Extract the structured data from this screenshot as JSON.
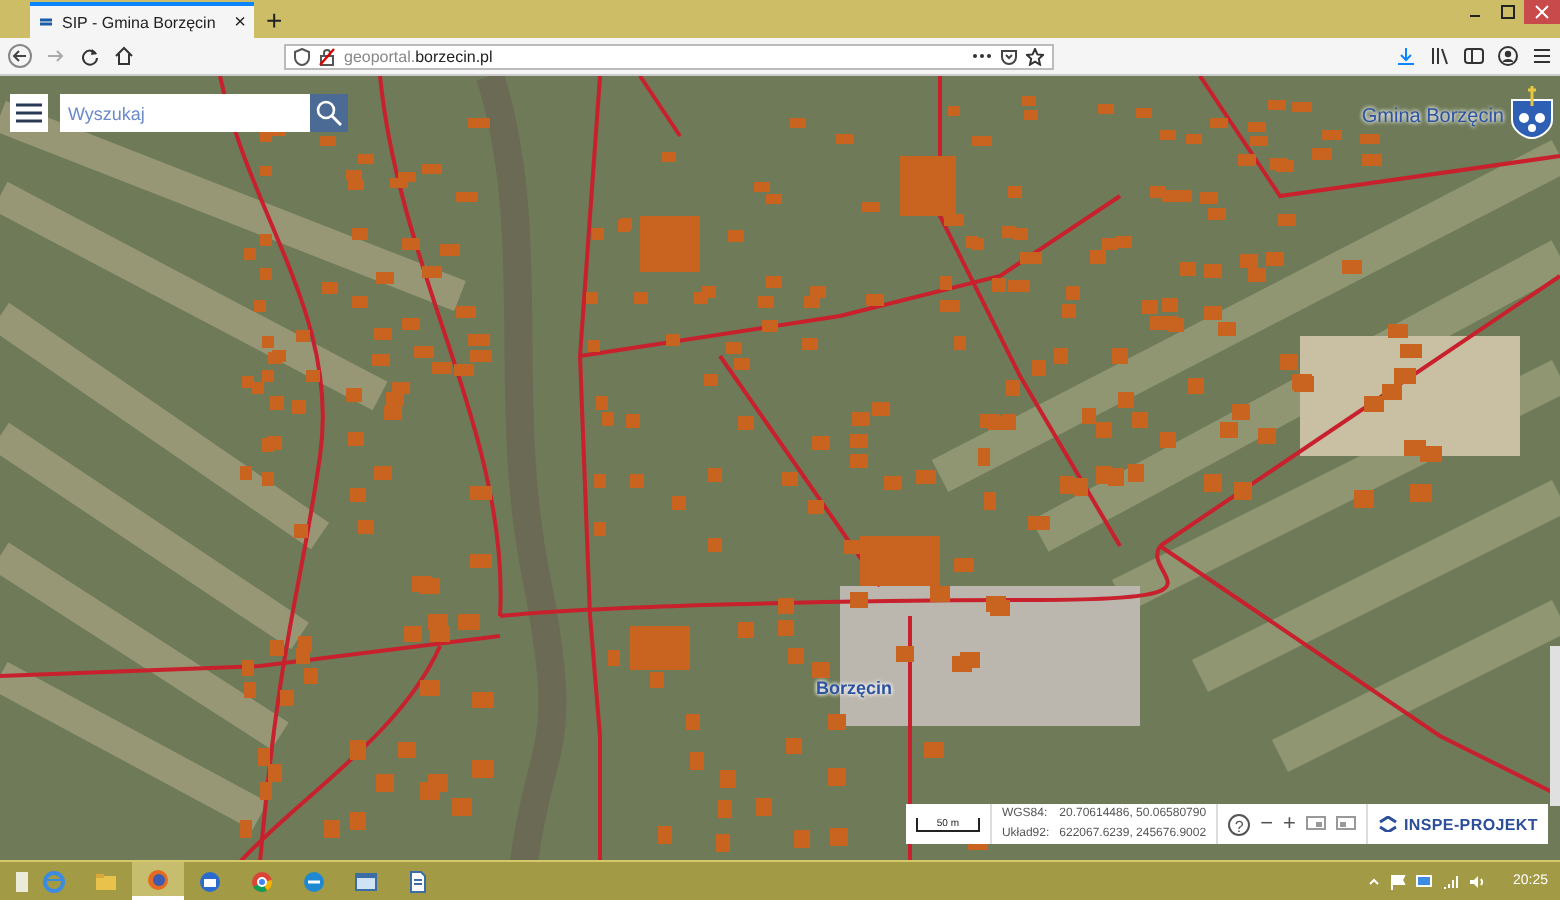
{
  "browser": {
    "tab": {
      "title": "SIP - Gmina Borzęcin",
      "close": "×",
      "selected": true
    },
    "new_tab": "+",
    "url": {
      "subdomain": "geoportal.",
      "domain": "borzecin.pl"
    }
  },
  "map": {
    "search": {
      "placeholder": "Wyszukaj"
    },
    "brand": "Gmina Borzęcin",
    "labels": [
      {
        "text": "Borzęcin"
      }
    ],
    "scale": "50 m",
    "coordinates": [
      {
        "system": "WGS84:",
        "value": "20.70614486, 50.06580790"
      },
      {
        "system": "Układ92:",
        "value": "622067.6239, 245676.9002"
      }
    ],
    "help": "?",
    "zoom_out": "−",
    "zoom_in": "+",
    "logo": "INSPE-PROJEKT"
  },
  "taskbar": {
    "apps": [
      {
        "kind": "ie",
        "selected": false
      },
      {
        "kind": "folder",
        "selected": false
      },
      {
        "kind": "firefox",
        "selected": true
      },
      {
        "kind": "mail",
        "selected": false
      },
      {
        "kind": "chrome",
        "selected": false
      },
      {
        "kind": "edge",
        "selected": false
      },
      {
        "kind": "window",
        "selected": false
      },
      {
        "kind": "document",
        "selected": false
      }
    ],
    "time": "20:25"
  }
}
